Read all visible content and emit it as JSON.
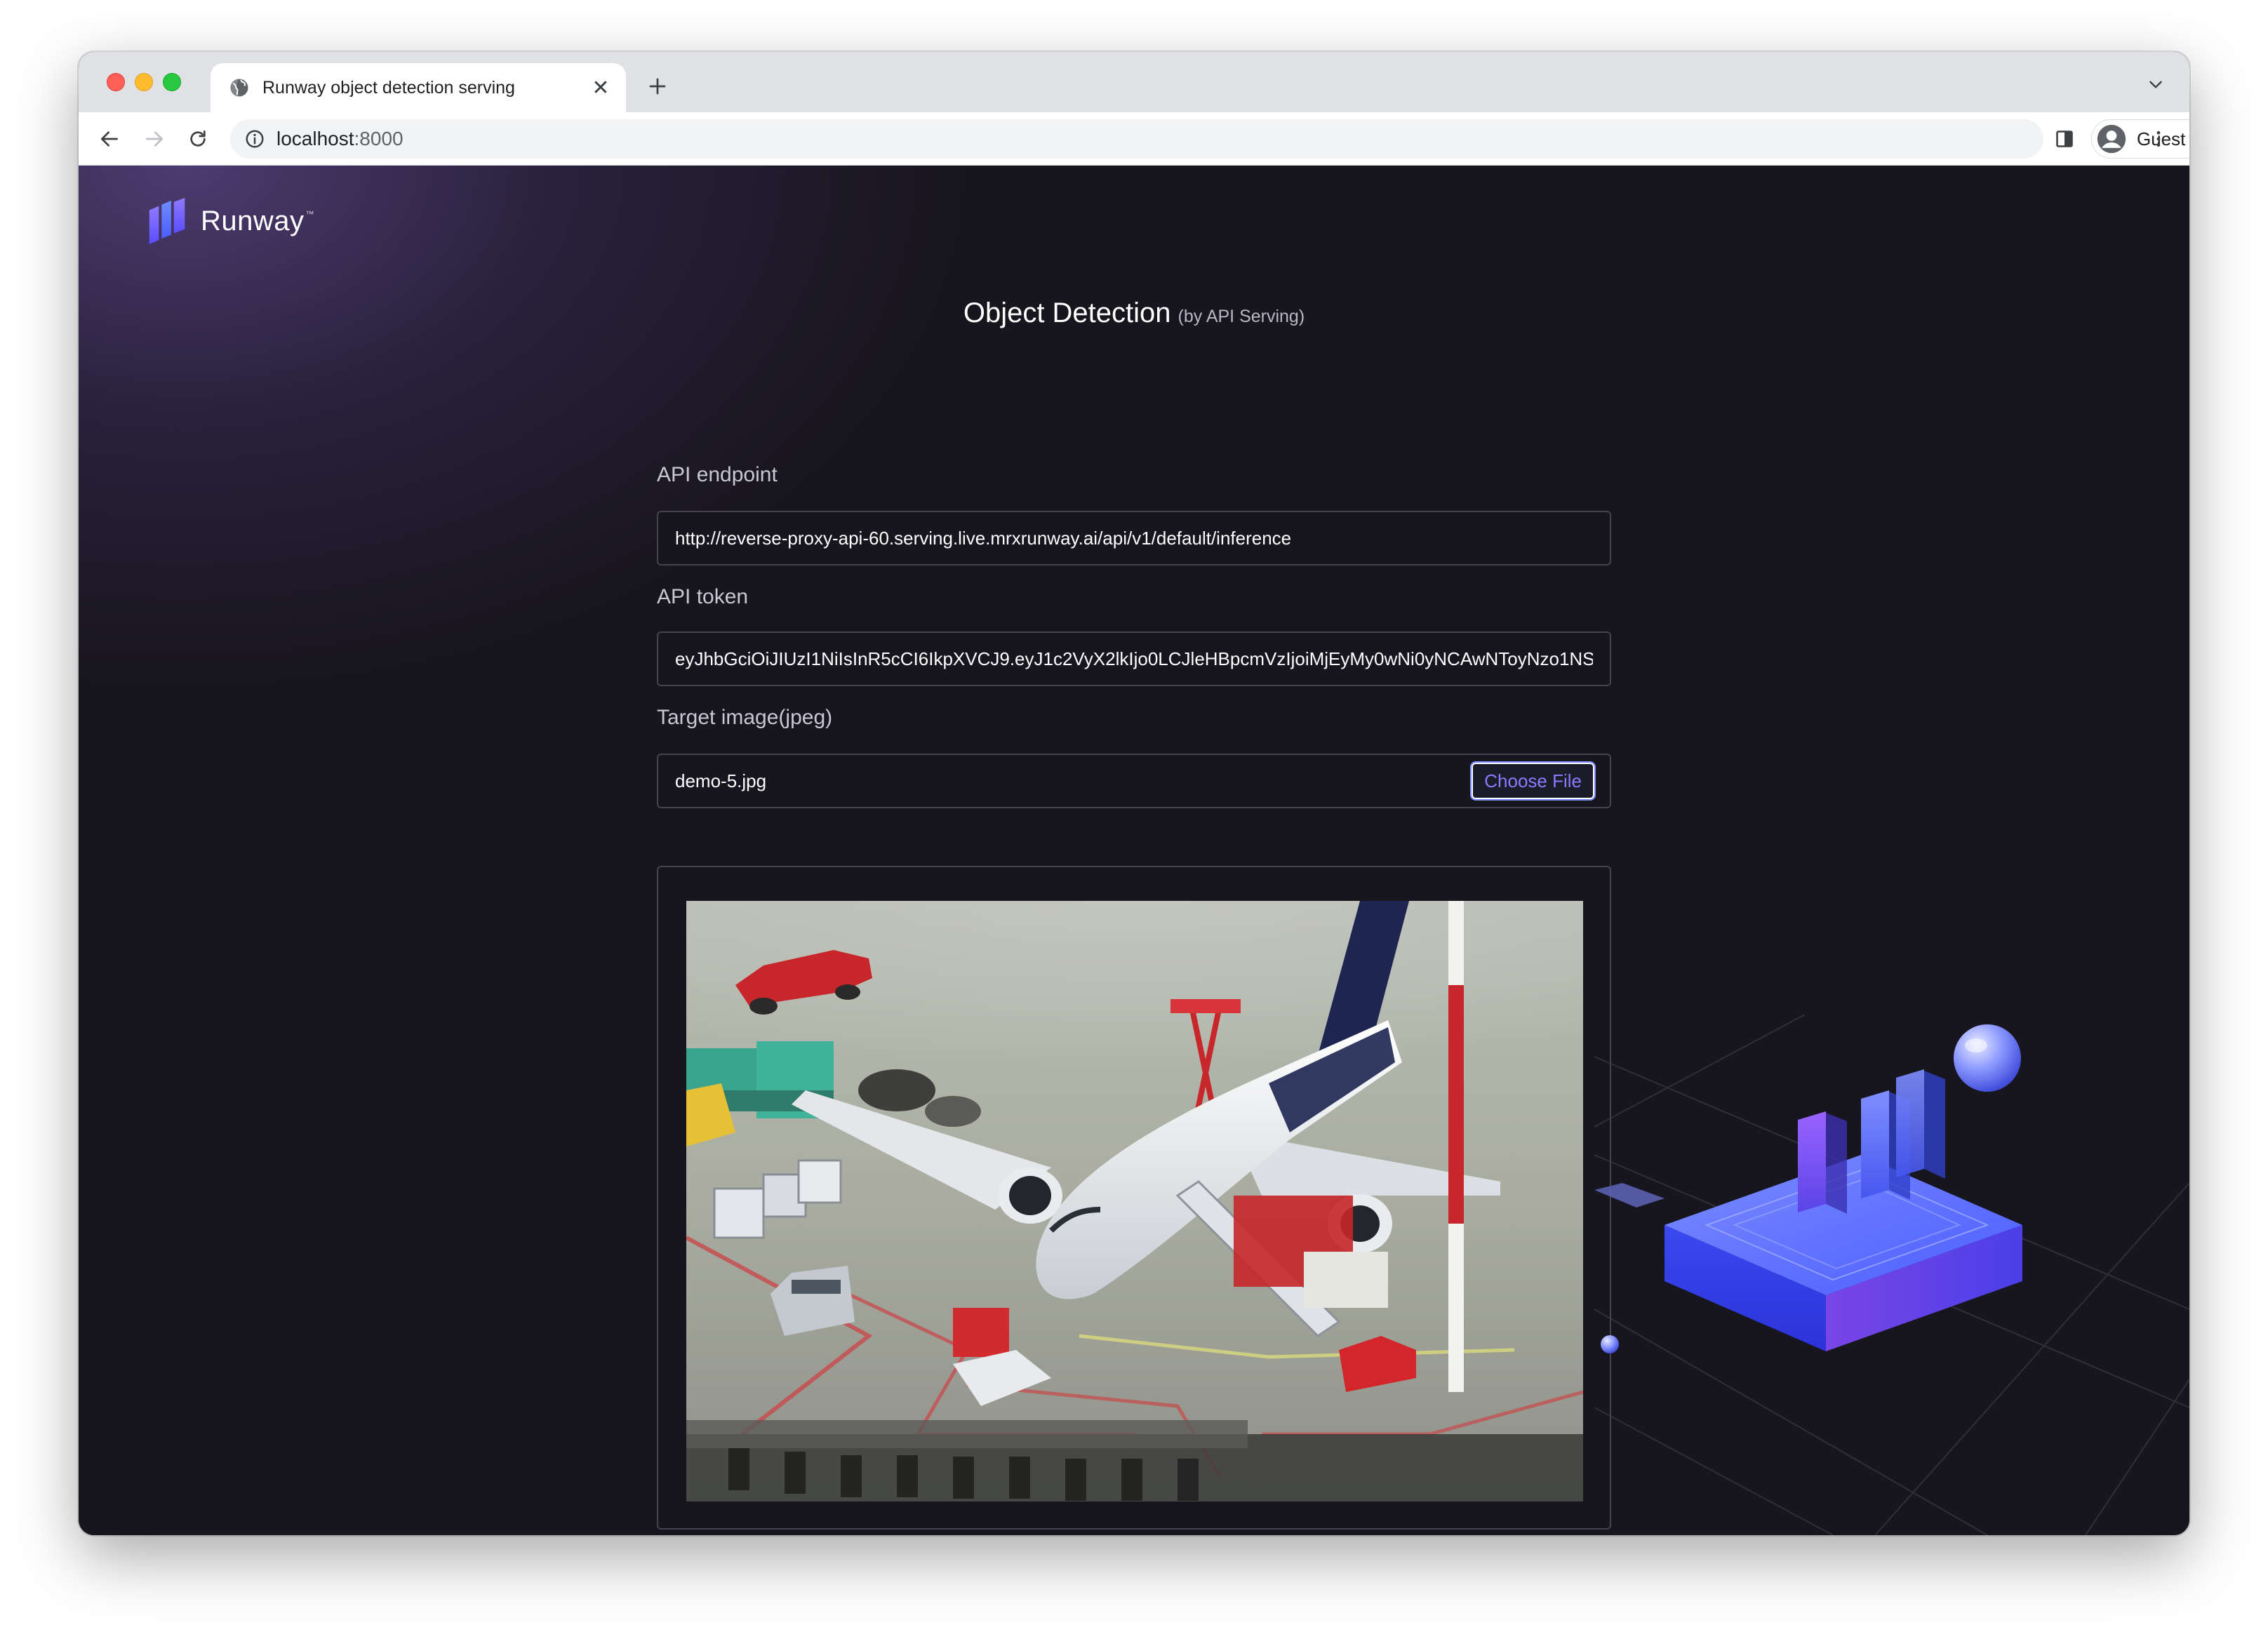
{
  "browser": {
    "tab_title": "Runway object detection serving",
    "close_glyph": "✕",
    "url_host": "localhost",
    "url_port": ":8000",
    "profile_name": "Guest"
  },
  "page": {
    "logo_text": "Runway",
    "logo_tm": "™",
    "title": "Object Detection",
    "subtitle": "(by API Serving)",
    "form": {
      "endpoint_label": "API endpoint",
      "endpoint_value": "http://reverse-proxy-api-60.serving.live.mrxrunway.ai/api/v1/default/inference",
      "token_label": "API token",
      "token_value": "eyJhbGciOiJIUzI1NiIsInR5cCI6IkpXVCJ9.eyJ1c2VyX2lkIjo0LCJleHBpcmVzIjoiMjEyMy0wNi0yNCAwNToyNzo1NS",
      "image_label": "Target image(jpeg)",
      "file_name": "demo-5.jpg",
      "choose_button": "Choose File"
    }
  },
  "icons": {
    "favicon": "globe-icon",
    "new_tab": "plus-icon",
    "tab_menu": "chevron-down-icon",
    "back": "arrow-left-icon",
    "forward": "arrow-right-icon",
    "reload": "reload-icon",
    "site_info": "info-icon",
    "side_panel": "side-panel-icon",
    "profile": "avatar-icon",
    "menu": "kebab-icon"
  },
  "colors": {
    "accent": "#7e8dff",
    "page_background": "#17151d",
    "field_border": "#45434f"
  }
}
